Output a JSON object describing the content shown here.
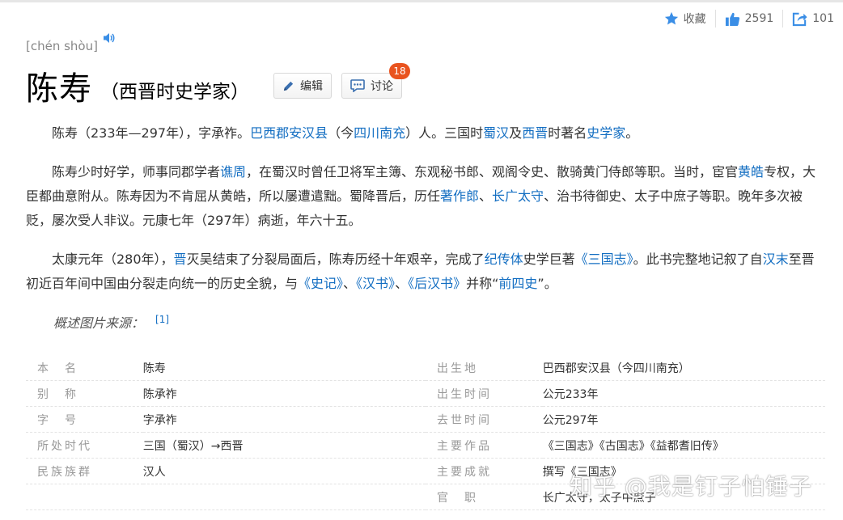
{
  "topbar": {
    "collect_label": "收藏",
    "like_count": "2591",
    "share_count": "101"
  },
  "header": {
    "pinyin": "[chén shòu]",
    "title": "陈寿",
    "subtitle": "（西晋时史学家）",
    "edit_label": "编辑",
    "discuss_label": "讨论",
    "discuss_badge": "18"
  },
  "summary": {
    "p1": [
      {
        "t": "陈寿（233年—297年），字承祚。"
      },
      {
        "t": "巴西郡安汉县",
        "link": true
      },
      {
        "t": "（今"
      },
      {
        "t": "四川南充",
        "link": true
      },
      {
        "t": "）人。三国时"
      },
      {
        "t": "蜀汉",
        "link": true
      },
      {
        "t": "及"
      },
      {
        "t": "西晋",
        "link": true
      },
      {
        "t": "时著名"
      },
      {
        "t": "史学家",
        "link": true
      },
      {
        "t": "。"
      }
    ],
    "p2": [
      {
        "t": "陈寿少时好学，师事同郡学者"
      },
      {
        "t": "谯周",
        "link": true
      },
      {
        "t": "，在蜀汉时曾任卫将军主簿、东观秘书郎、观阁令史、散骑黄门侍郎等职。当时，宦官"
      },
      {
        "t": "黄皓",
        "link": true
      },
      {
        "t": "专权，大臣都曲意附从。陈寿因为不肯屈从黄皓，所以屡遭遣黜。蜀降晋后，历任"
      },
      {
        "t": "著作郎",
        "link": true
      },
      {
        "t": "、"
      },
      {
        "t": "长广太守",
        "link": true
      },
      {
        "t": "、治书待御史、太子中庶子等职。晚年多次被贬，屡次受人非议。元康七年（297年）病逝，年六十五。"
      }
    ],
    "p3": [
      {
        "t": "太康元年（280年），"
      },
      {
        "t": "晋",
        "link": true
      },
      {
        "t": "灭吴结束了分裂局面后，陈寿历经十年艰辛，完成了"
      },
      {
        "t": "纪传体",
        "link": true
      },
      {
        "t": "史学巨著"
      },
      {
        "t": "《三国志》",
        "link": true
      },
      {
        "t": "。此书完整地记叙了自"
      },
      {
        "t": "汉末",
        "link": true
      },
      {
        "t": "至晋初近百年间中国由分裂走向统一的历史全貌，与"
      },
      {
        "t": "《史记》",
        "link": true
      },
      {
        "t": "、"
      },
      {
        "t": "《汉书》",
        "link": true
      },
      {
        "t": "、"
      },
      {
        "t": "《后汉书》",
        "link": true
      },
      {
        "t": "并称“"
      },
      {
        "t": "前四史",
        "link": true
      },
      {
        "t": "”。"
      }
    ],
    "caption": "概述图片来源：",
    "caption_ref": "[1]"
  },
  "basic_info": {
    "rows": [
      {
        "k1": "本　名",
        "v1": "陈寿",
        "k2": "出生地",
        "v2": "巴西郡安汉县（今四川南充）"
      },
      {
        "k1": "别　称",
        "v1": "陈承祚",
        "k2": "出生时间",
        "v2": "公元233年"
      },
      {
        "k1": "字　号",
        "v1": "字承祚",
        "k2": "去世时间",
        "v2": "公元297年"
      },
      {
        "k1": "所处时代",
        "v1": "三国（蜀汉）→西晋",
        "k2": "主要作品",
        "v2": "《三国志》《古国志》《益都耆旧传》"
      },
      {
        "k1": "民族族群",
        "v1": "汉人",
        "k2": "主要成就",
        "v2": "撰写《三国志》"
      },
      {
        "k1": "",
        "v1": "",
        "k2": "官　职",
        "v2": "长广太守，太子中庶子"
      }
    ]
  },
  "watermark": "知乎 @我是钉子怕锤子",
  "colors": {
    "link": "#136ec2",
    "accent_icon": "#3a8ee6",
    "badge": "#e9531e",
    "key_text": "#999999"
  },
  "icons": [
    "star-icon",
    "thumbs-up-icon",
    "share-icon",
    "speaker-icon",
    "pencil-icon",
    "chat-bubble-icon"
  ]
}
